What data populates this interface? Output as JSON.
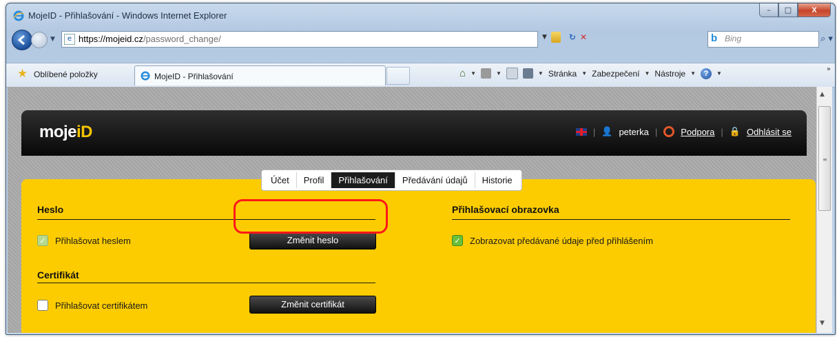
{
  "window": {
    "title": "MojeID - Přihlašování - Windows Internet Explorer",
    "buttons": {
      "minimize": "–",
      "maximize": "□",
      "close": "X"
    }
  },
  "address": {
    "url_host": "https://mojeid.cz",
    "url_rest": "/password_change/",
    "search_engine": "Bing",
    "search_placeholder": "Bing"
  },
  "favorites": {
    "label": "Oblíbené položky",
    "tab_title": "MojeID - Přihlašování"
  },
  "commandbar": {
    "items": [
      "Stránka",
      "Zabezpečení",
      "Nástroje"
    ]
  },
  "site": {
    "logo_text": "moje",
    "logo_accent": "iD",
    "username": "peterka",
    "support_link": "Podpora",
    "logout_link": "Odhlásit se",
    "tabs": [
      "Účet",
      "Profil",
      "Přihlašování",
      "Předávání údajů",
      "Historie"
    ],
    "active_tab": "Přihlašování"
  },
  "content": {
    "password_section": {
      "title": "Heslo",
      "checkbox_label": "Přihlašovat heslem",
      "checked": true,
      "button": "Změnit heslo"
    },
    "certificate_section": {
      "title": "Certifikát",
      "checkbox_label": "Přihlašovat certifikátem",
      "checked": false,
      "button": "Změnit certifikát"
    },
    "login_screen_section": {
      "title": "Přihlašovací obrazovka",
      "checkbox_label": "Zobrazovat předávané údaje před přihlášením",
      "checked": true
    }
  },
  "colors": {
    "panel_yellow": "#fccc00",
    "header_black": "#111111",
    "highlight_red": "#ff1818"
  }
}
